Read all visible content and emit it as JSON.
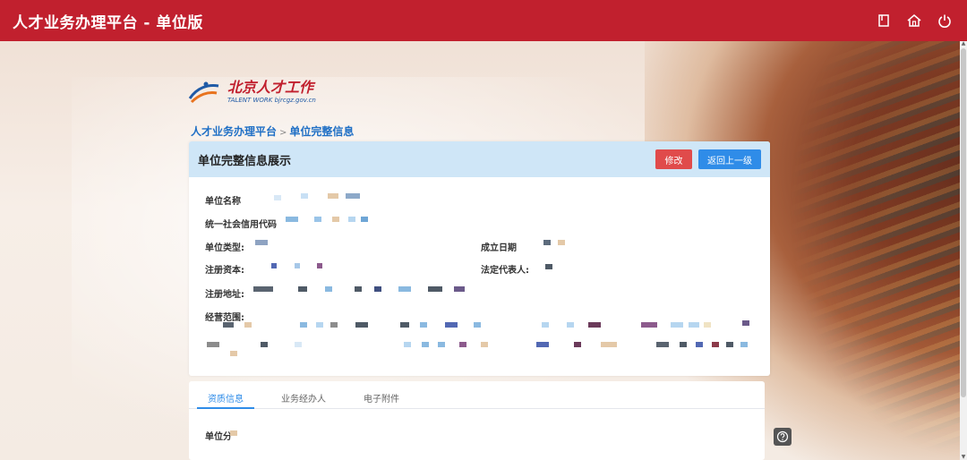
{
  "topbar": {
    "title": "人才业务办理平台 - 单位版",
    "icons": [
      "bookmark-icon",
      "home-icon",
      "power-icon"
    ]
  },
  "logo": {
    "main": "北京人才工作",
    "sub": "TALENT WORK  bjrcgz.gov.cn"
  },
  "breadcrumb": {
    "root": "人才业务办理平台",
    "separator": ">",
    "current": "单位完整信息"
  },
  "panel": {
    "title": "单位完整信息展示",
    "edit_label": "修改",
    "back_label": "返回上一级",
    "fields": {
      "name": "单位名称",
      "credit_code": "统一社会信用代码",
      "type": "单位类型:",
      "established": "成立日期",
      "capital": "注册资本:",
      "legal_rep": "法定代表人:",
      "address": "注册地址:",
      "scope": "经营范围:"
    }
  },
  "tabs": {
    "items": [
      "资质信息",
      "业务经办人",
      "电子附件"
    ],
    "active_index": 0,
    "first_field": "单位分"
  },
  "colors": {
    "brand_red": "#c1202e",
    "header_blue": "#cfe6f7",
    "link_blue": "#1f6fc5",
    "edit_red": "#e04b4b",
    "back_blue": "#2f8ce8"
  }
}
